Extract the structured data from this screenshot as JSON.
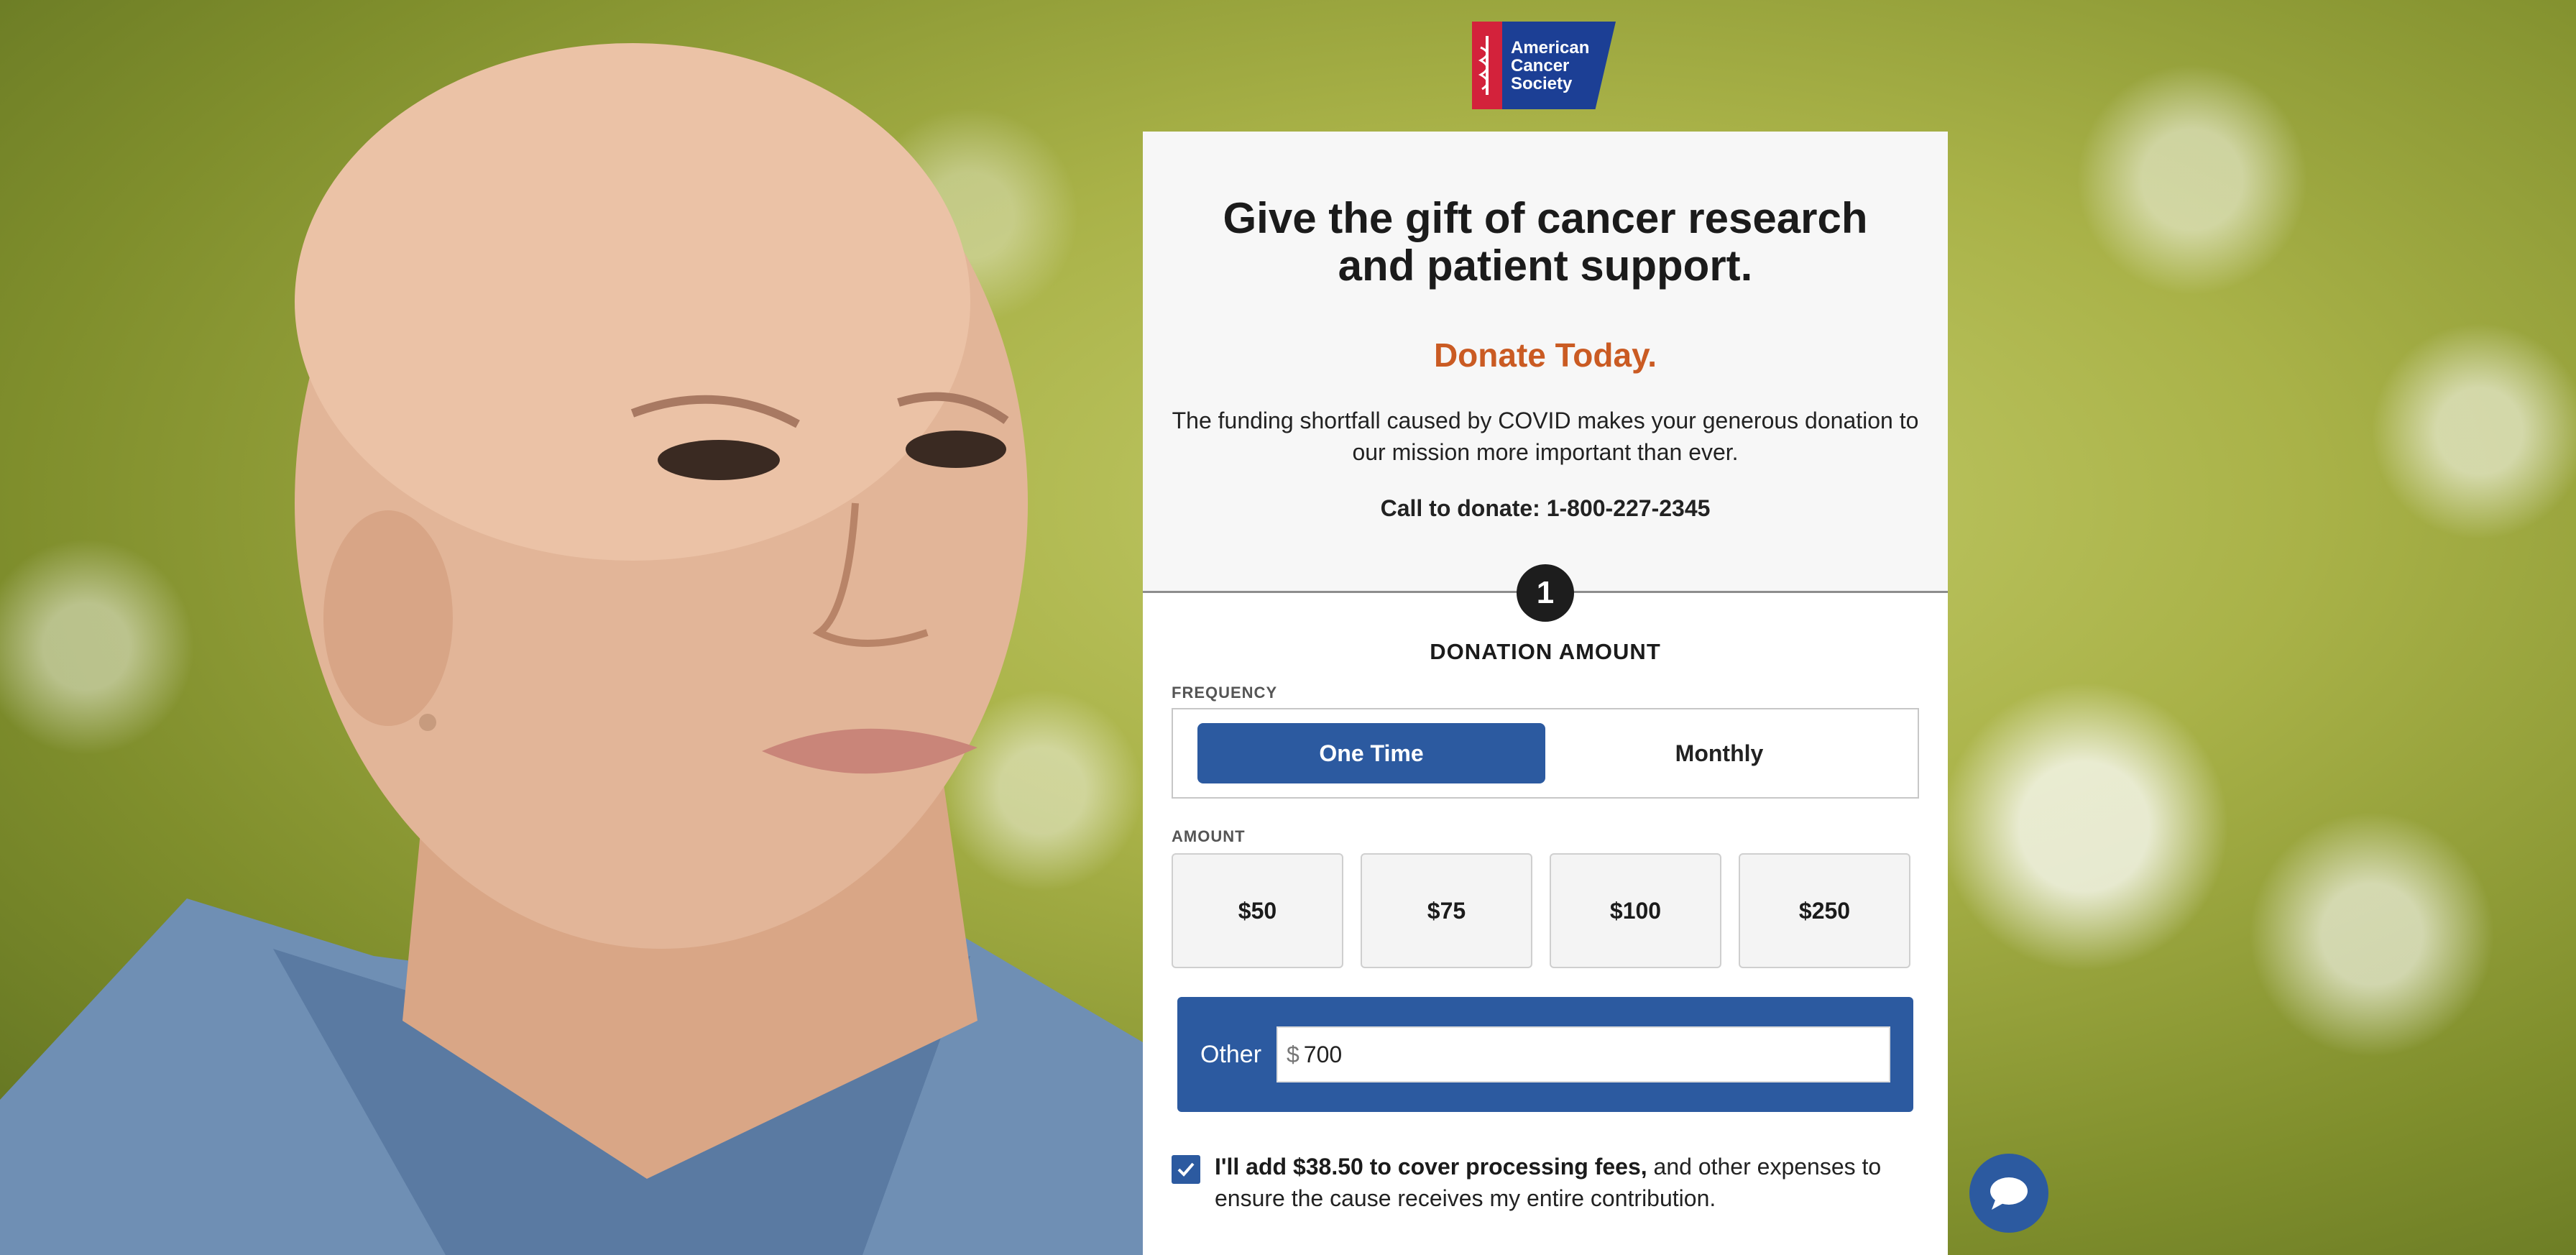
{
  "logo": {
    "line1": "American",
    "line2": "Cancer",
    "line3": "Society"
  },
  "hero": {
    "headline": "Give the gift of cancer research and patient support.",
    "donate_today": "Donate Today.",
    "intro": "The funding shortfall caused by COVID makes your generous donation to our mission more important than ever.",
    "call": "Call to donate: 1-800-227-2345"
  },
  "step": {
    "number": "1",
    "title": "DONATION AMOUNT"
  },
  "frequency": {
    "label": "FREQUENCY",
    "options": [
      "One Time",
      "Monthly"
    ],
    "selected": "One Time"
  },
  "amount": {
    "label": "AMOUNT",
    "options": [
      "$50",
      "$75",
      "$100",
      "$250"
    ],
    "other_label": "Other",
    "currency_symbol": "$",
    "other_value": "700"
  },
  "fees": {
    "checked": true,
    "bold_text": "I'll add $38.50 to cover processing fees,",
    "rest_text": " and other expenses to ensure the cause receives my entire contribution."
  },
  "colors": {
    "accent_blue": "#2c5aa0",
    "donate_orange": "#ca5b23",
    "acs_red": "#d3223b",
    "acs_blue": "#1c3f95"
  },
  "icons": [
    "caduceus-icon",
    "checkmark-icon",
    "chat-bubble-icon"
  ]
}
